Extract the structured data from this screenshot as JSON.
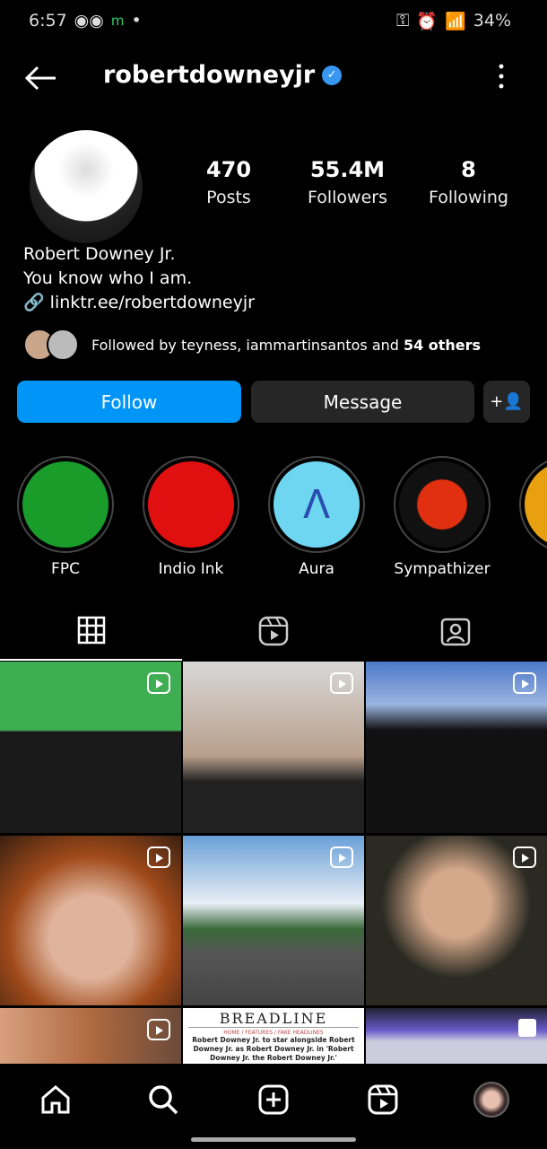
{
  "status_bar": {
    "time": "6:57",
    "battery": "34%"
  },
  "header": {
    "username": "robertdowneyjr",
    "verified": true
  },
  "profile": {
    "posts": {
      "value": "470",
      "label": "Posts"
    },
    "followers": {
      "value": "55.4M",
      "label": "Followers"
    },
    "following": {
      "value": "8",
      "label": "Following"
    },
    "name": "Robert Downey Jr.",
    "bio": "You know who I am.",
    "link": "linktr.ee/robertdowneyjr",
    "followed_by": "Followed by teyness, iammartinsantos and ",
    "followed_by_bold": "54 others"
  },
  "actions": {
    "follow": "Follow",
    "message": "Message"
  },
  "highlights": [
    {
      "label": "FPC"
    },
    {
      "label": "Indio Ink"
    },
    {
      "label": "Aura"
    },
    {
      "label": "Sympathizer"
    }
  ],
  "grid": {
    "breadline_title": "BREADLINE",
    "breadline_nav": "HOME / FEATURES / FAKE HEADLINES",
    "breadline_text": "Robert Downey Jr. to star alongside Robert Downey Jr. as Robert Downey Jr. in 'Robert Downey Jr. the Robert Downey Jr.'"
  },
  "colors": {
    "accent": "#0095f6",
    "button_dark": "#262626",
    "verified": "#3897f0"
  }
}
